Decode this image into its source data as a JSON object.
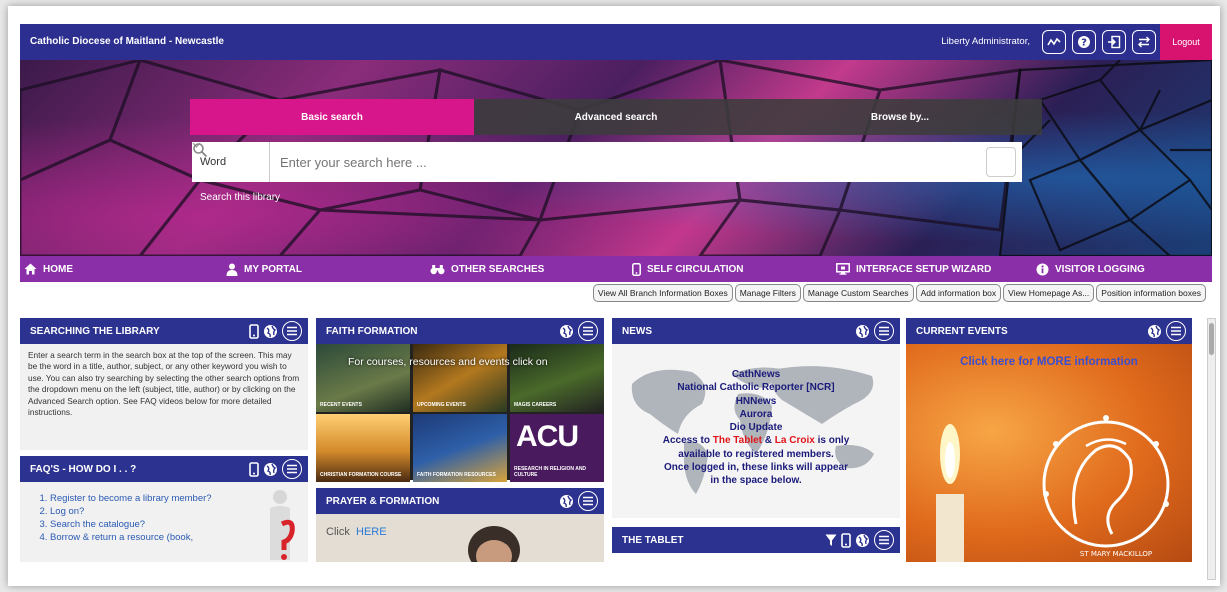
{
  "header": {
    "site_title": "Catholic Diocese of Maitland - Newcastle",
    "user_name": "Liberty Administrator,",
    "logout_label": "Logout",
    "icons": [
      "activity-icon",
      "help-icon",
      "login-icon",
      "switch-icon"
    ]
  },
  "search": {
    "tabs": [
      {
        "label": "Basic search",
        "active": true
      },
      {
        "label": "Advanced search",
        "active": false
      },
      {
        "label": "Browse by...",
        "active": false
      }
    ],
    "select_value": "Word",
    "placeholder": "Enter your search here ...",
    "scope_label": "Search this library"
  },
  "nav": {
    "items": [
      {
        "label": "HOME",
        "icon": "home-icon"
      },
      {
        "label": "MY PORTAL",
        "icon": "user-icon"
      },
      {
        "label": "OTHER SEARCHES",
        "icon": "binoculars-icon"
      },
      {
        "label": "SELF CIRCULATION",
        "icon": "mobile-icon"
      },
      {
        "label": "INTERFACE SETUP WIZARD",
        "icon": "monitor-icon"
      },
      {
        "label": "VISITOR LOGGING",
        "icon": "info-icon"
      }
    ]
  },
  "admin_buttons": [
    "View All Branch Information Boxes",
    "Manage Filters",
    "Manage Custom Searches",
    "Add information box",
    "View Homepage As...",
    "Position information boxes"
  ],
  "panels": {
    "searching": {
      "title": "SEARCHING THE LIBRARY",
      "text": "Enter a search term in the search box at the top of the screen.  This may be the word in a title, author, subject, or any other keyword you wish to use.  You can also try searching by selecting the other search options from the dropdown menu on the left (subject, title, author) or by clicking on the Advanced Search option. See FAQ videos below for more detailed instructions."
    },
    "faq": {
      "title": "FAQ'S - HOW DO I . . ?",
      "items": [
        "Register to become a library member?",
        "Log on?",
        "Search the catalogue?",
        "Borrow & return a resource (book,"
      ]
    },
    "faith": {
      "title": "FAITH FORMATION",
      "overlay_text": "For courses, resources and events click on",
      "tiles": [
        "RECENT EVENTS",
        "UPCOMING EVENTS",
        "MAGIS CAREERS",
        "CHRISTIAN FORMATION COURSE",
        "FAITH FORMATION RESOURCES",
        "RESEARCH IN RELIGION AND CULTURE"
      ],
      "acu_text": "ACU"
    },
    "prayer": {
      "title": "PRAYER & FORMATION",
      "link_prefix": "Click",
      "link_text": "HERE"
    },
    "news": {
      "title": "NEWS",
      "links": [
        "CathNews",
        "National Catholic Reporter [NCR]",
        "HNNews",
        "Aurora",
        "Dio Update"
      ],
      "access_prefix": "Access to ",
      "tablet": "The Tablet",
      "amp": " & ",
      "lacroix": "La Croix",
      "access_suffix": " is only",
      "lines": [
        "available to registered members.",
        "Once logged in, these links will appear",
        "in the space below."
      ]
    },
    "tablet": {
      "title": "THE TABLET"
    },
    "events": {
      "title": "CURRENT EVENTS",
      "link_text": "Click here for MORE information",
      "logo_text": "ST MARY MACKILLOP"
    }
  },
  "colors": {
    "brand_blue": "#2c2f8f",
    "magenta": "#d8136f",
    "nav_purple": "#8b2fa8",
    "link_blue": "#2a5ab3"
  }
}
